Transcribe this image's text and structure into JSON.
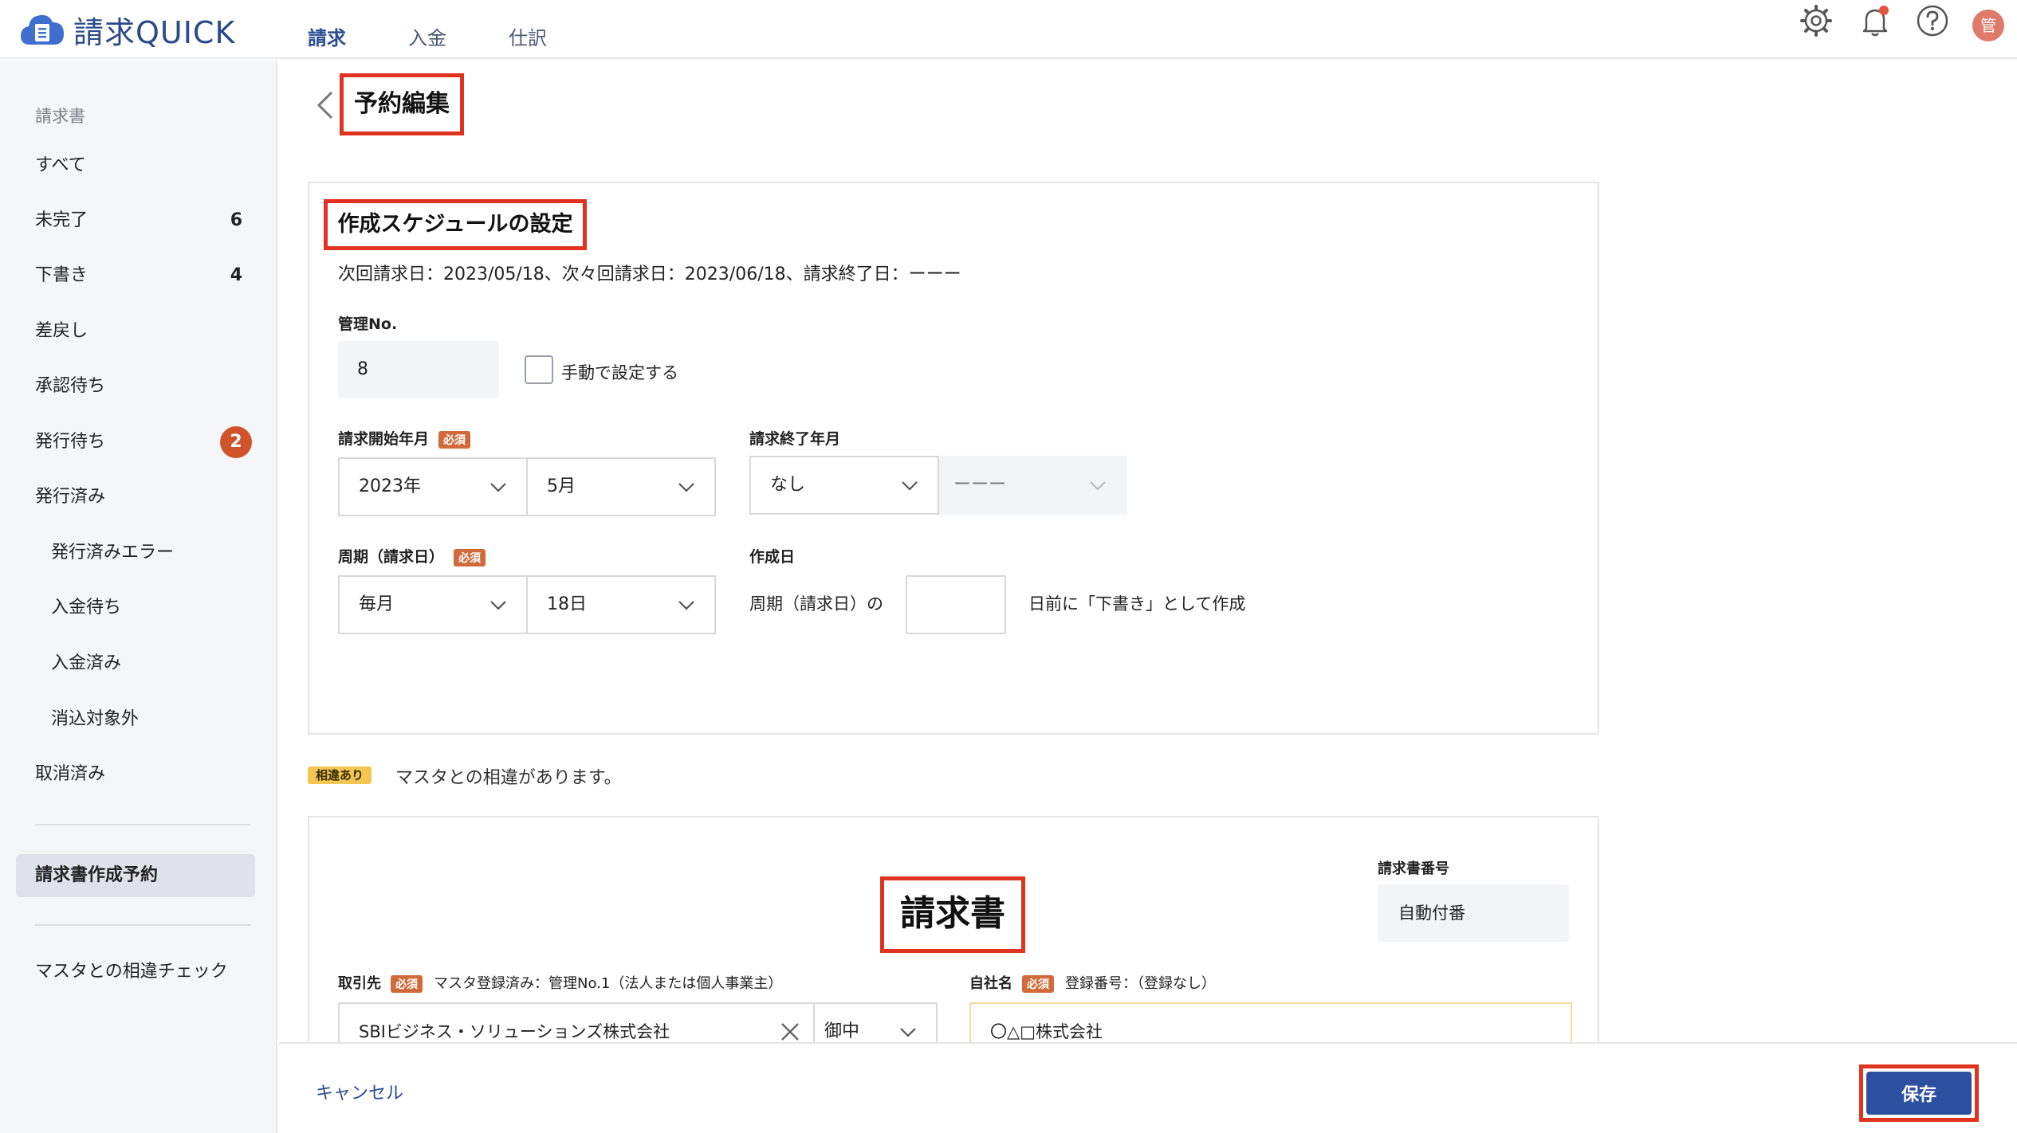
{
  "app": {
    "name": "請求QUICK",
    "avatar_initial": "管",
    "brand_color": "#2a4a8a",
    "accent_color": "#e0331f"
  },
  "topnav": {
    "items": [
      "請求",
      "入金",
      "仕訳"
    ],
    "active_index": 0
  },
  "icons": {
    "settings": "gear-icon",
    "notifications": "bell-icon",
    "help": "question-circle-icon"
  },
  "sidebar": {
    "heading": "請求書",
    "items": [
      {
        "label": "すべて",
        "count": ""
      },
      {
        "label": "未完了",
        "count": "6"
      },
      {
        "label": "下書き",
        "count": "4"
      },
      {
        "label": "差戻し",
        "count": ""
      },
      {
        "label": "承認待ち",
        "count": ""
      },
      {
        "label": "発行待ち",
        "badge": "2"
      },
      {
        "label": "発行済み",
        "count": ""
      },
      {
        "label": "発行済みエラー",
        "count": ""
      },
      {
        "label": "入金待ち",
        "count": ""
      },
      {
        "label": "入金済み",
        "count": ""
      },
      {
        "label": "消込対象外",
        "count": ""
      },
      {
        "label": "取消済み",
        "count": ""
      }
    ],
    "selected": "請求書作成予約",
    "bottom": "マスタとの相違チェック"
  },
  "page": {
    "title": "予約編集"
  },
  "schedule": {
    "section_title": "作成スケジュールの設定",
    "summary": "次回請求日：2023/05/18、次々回請求日：2023/06/18、請求終了日：ーーー",
    "management_no_label": "管理No.",
    "management_no_value": "8",
    "manual_checkbox_label": "手動で設定する",
    "start_label": "請求開始年月",
    "required": "必須",
    "start_year": "2023年",
    "start_month": "5月",
    "end_label": "請求終了年月",
    "end_value": "なし",
    "end_month": "ーーー",
    "cycle_label": "周期（請求日）",
    "cycle_value": "毎月",
    "cycle_day": "18日",
    "created_label": "作成日",
    "created_prefix": "周期（請求日）の",
    "created_value": "",
    "created_suffix": "日前に「下書き」として作成"
  },
  "diff": {
    "tag": "相違あり",
    "message": "マスタとの相違があります。"
  },
  "invoice": {
    "title": "請求書",
    "number_label": "請求書番号",
    "number_value": "自動付番",
    "client_label": "取引先",
    "client_required": "必須",
    "client_note": "マスタ登録済み：管理No.1（法人または個人事業主）",
    "client_value": "SBIビジネス・ソリューションズ株式会社",
    "honorific": "御中",
    "company_label": "自社名",
    "company_required": "必須",
    "company_note": "登録番号：（登録なし）",
    "company_value": "〇△□株式会社"
  },
  "footer": {
    "cancel": "キャンセル",
    "save": "保存"
  }
}
